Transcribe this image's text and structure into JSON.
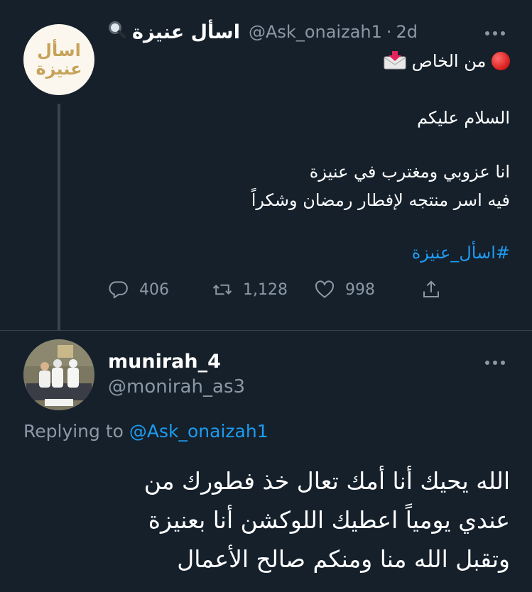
{
  "tweet": {
    "avatar_text_line1": "اسأل",
    "avatar_text_line2": "عنيزة",
    "display_name": "اسأل عنيزة",
    "handle": "@Ask_onaizah1",
    "time": "2d",
    "separator": "·",
    "icons": {
      "magnifier": "magnifying-glass-icon",
      "red_circle": "red-circle-icon",
      "mail": "incoming-envelope-icon",
      "more": "more-options-icon"
    },
    "lines": {
      "l1": "من الخاص",
      "l2": "السلام عليكم",
      "l3": "انا عزوبي ومغترب في عنيزة",
      "l4": "فيه اسر منتجه لإفطار رمضان وشكراً",
      "hashtag": "#اسأل_عنيزة"
    },
    "actions": {
      "replies": "406",
      "retweets": "1,128",
      "likes": "998"
    }
  },
  "reply": {
    "display_name": "munirah_4",
    "handle": "@monirah_as3",
    "replying_prefix": "Replying to",
    "replying_handle": "@Ask_onaizah1",
    "lines": {
      "l1": "الله يحيك  أنا أمك تعال خذ فطورك من",
      "l2": "عندي يومياً  اعطيك اللوكشن  أنا بعنيزة",
      "l3": "وتقبل الله منا ومنكم صالح الأعمال"
    }
  },
  "colors": {
    "background": "#15202b",
    "text": "#ffffff",
    "muted": "#8b98a5",
    "accent": "#1d9bf0",
    "divider": "#38444d"
  }
}
